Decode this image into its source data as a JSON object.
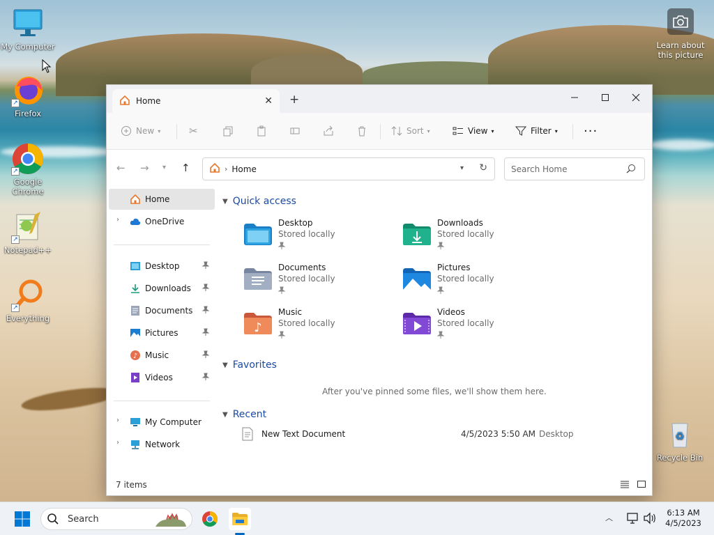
{
  "desktop": {
    "icons": [
      {
        "label": "My Computer"
      },
      {
        "label": "Firefox"
      },
      {
        "label": "Google Chrome"
      },
      {
        "label": "Notepad++"
      },
      {
        "label": "Everything"
      },
      {
        "label": "Recycle Bin"
      }
    ],
    "learn_label": "Learn about this picture"
  },
  "window": {
    "tab_title": "Home",
    "toolbar": {
      "new_label": "New",
      "sort_label": "Sort",
      "view_label": "View",
      "filter_label": "Filter"
    },
    "address": {
      "crumb": "Home"
    },
    "search_placeholder": "Search Home",
    "nav": {
      "home": "Home",
      "onedrive": "OneDrive",
      "pinned": [
        {
          "label": "Desktop"
        },
        {
          "label": "Downloads"
        },
        {
          "label": "Documents"
        },
        {
          "label": "Pictures"
        },
        {
          "label": "Music"
        },
        {
          "label": "Videos"
        }
      ],
      "my_computer": "My Computer",
      "network": "Network"
    },
    "sections": {
      "quick_access": "Quick access",
      "favorites": "Favorites",
      "recent": "Recent"
    },
    "quick_access": [
      {
        "name": "Desktop",
        "status": "Stored locally"
      },
      {
        "name": "Downloads",
        "status": "Stored locally"
      },
      {
        "name": "Documents",
        "status": "Stored locally"
      },
      {
        "name": "Pictures",
        "status": "Stored locally"
      },
      {
        "name": "Music",
        "status": "Stored locally"
      },
      {
        "name": "Videos",
        "status": "Stored locally"
      }
    ],
    "favorites_empty": "After you've pinned some files, we'll show them here.",
    "recent_files": [
      {
        "name": "New Text Document",
        "date": "4/5/2023 5:50 AM",
        "location": "Desktop"
      }
    ],
    "status_items": "7 items"
  },
  "taskbar": {
    "search_label": "Search",
    "time": "6:13 AM",
    "date": "4/5/2023"
  },
  "colors": {
    "accent": "#0067c0",
    "section_heading": "#1b4aa3"
  }
}
